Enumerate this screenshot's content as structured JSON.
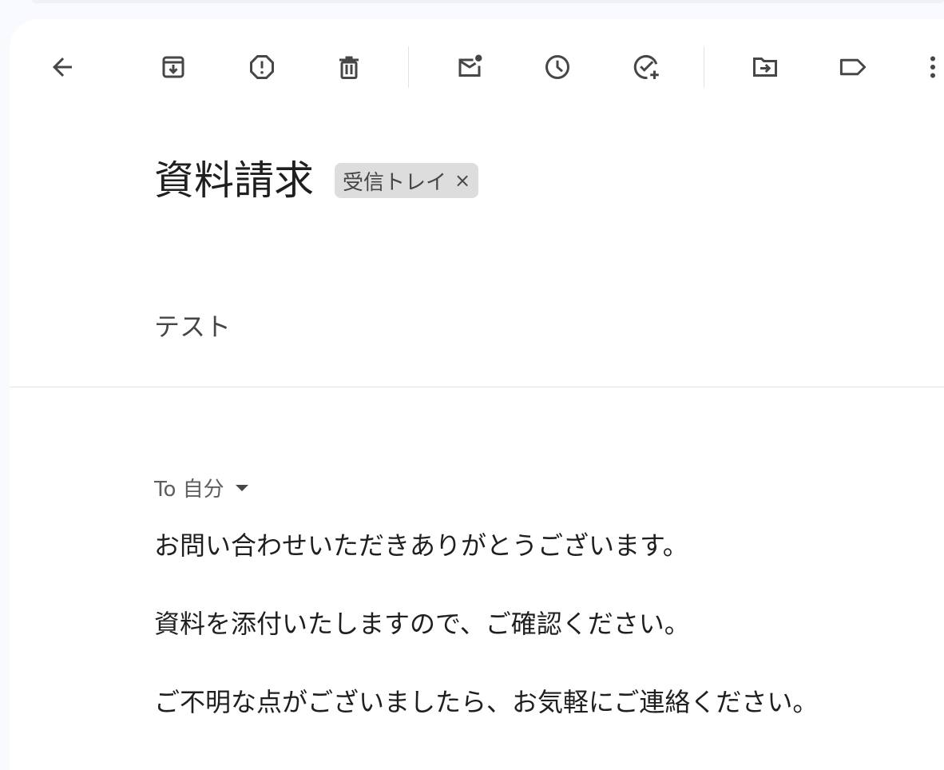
{
  "toolbar": {
    "buttons": [
      {
        "name": "back",
        "icon": "arrow-left-icon"
      },
      {
        "name": "archive",
        "icon": "archive-icon"
      },
      {
        "name": "report-spam",
        "icon": "report-spam-icon"
      },
      {
        "name": "delete",
        "icon": "trash-icon"
      },
      {
        "name": "mark-unread",
        "icon": "mark-unread-icon"
      },
      {
        "name": "snooze",
        "icon": "clock-icon"
      },
      {
        "name": "add-to-tasks",
        "icon": "add-task-icon"
      },
      {
        "name": "move-to",
        "icon": "move-to-folder-icon"
      },
      {
        "name": "labels",
        "icon": "label-icon"
      },
      {
        "name": "more",
        "icon": "more-vert-icon"
      }
    ],
    "icon_color": "#444746"
  },
  "email": {
    "subject": "資料請求",
    "label": "受信トレイ",
    "label_remove": "×",
    "snippet": "テスト",
    "recipient": "To 自分",
    "body": [
      "お問い合わせいただきありがとうございます。",
      "資料を添付いたしますので、ご確認ください。",
      "ご不明な点がございましたら、お気軽にご連絡ください。"
    ]
  },
  "colors": {
    "background": "#f8fafd",
    "panel": "#ffffff",
    "chip": "#dddddd",
    "text_primary": "#1f1f1f",
    "text_secondary": "#444746"
  }
}
